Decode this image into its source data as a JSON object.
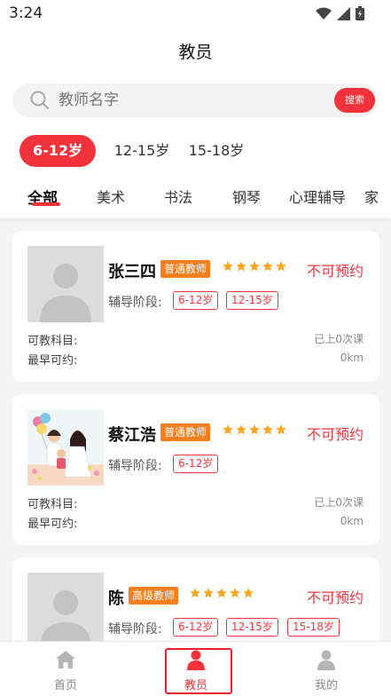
{
  "status_bar": {
    "time": "3:24",
    "icons": [
      "wifi-icon",
      "signal-icon",
      "battery-charging-icon"
    ]
  },
  "header": {
    "title": "教员"
  },
  "search": {
    "placeholder": "教师名字",
    "button_label": "搜索"
  },
  "age_tabs": [
    {
      "label": "6-12岁",
      "active": true
    },
    {
      "label": "12-15岁",
      "active": false
    },
    {
      "label": "15-18岁",
      "active": false
    }
  ],
  "category_tabs": [
    {
      "label": "全部",
      "active": true
    },
    {
      "label": "美术",
      "active": false
    },
    {
      "label": "书法",
      "active": false
    },
    {
      "label": "钢琴",
      "active": false
    },
    {
      "label": "心理辅导",
      "active": false
    },
    {
      "label": "家",
      "active": false
    }
  ],
  "teachers": [
    {
      "name": "张三四",
      "level": "普通教师",
      "rating": 5,
      "booking_status": "不可预约",
      "stage_label": "辅导阶段:",
      "stages": [
        "6-12岁",
        "12-15岁"
      ],
      "subjects_label": "可教科目:",
      "earliest_label": "最早可约:",
      "lessons": "已上0次课",
      "distance": "0km",
      "avatar": "placeholder"
    },
    {
      "name": "蔡江浩",
      "level": "普通教师",
      "rating": 5,
      "booking_status": "不可预约",
      "stage_label": "辅导阶段:",
      "stages": [
        "6-12岁"
      ],
      "subjects_label": "可教科目:",
      "earliest_label": "最早可约:",
      "lessons": "已上0次课",
      "distance": "0km",
      "avatar": "cartoon-family-photo"
    },
    {
      "name": "陈",
      "level": "高级教师",
      "rating": 5,
      "booking_status": "不可预约",
      "stage_label": "辅导阶段:",
      "stages": [
        "6-12岁",
        "12-15岁",
        "15-18岁"
      ],
      "avatar": "placeholder"
    }
  ],
  "bottom_nav": [
    {
      "label": "首页",
      "icon": "home-icon",
      "active": false
    },
    {
      "label": "教员",
      "icon": "teacher-icon",
      "active": true
    },
    {
      "label": "我的",
      "icon": "profile-icon",
      "active": false
    }
  ],
  "colors": {
    "accent": "#f2333b",
    "badge": "#f57f1e",
    "star": "#f5a623"
  }
}
